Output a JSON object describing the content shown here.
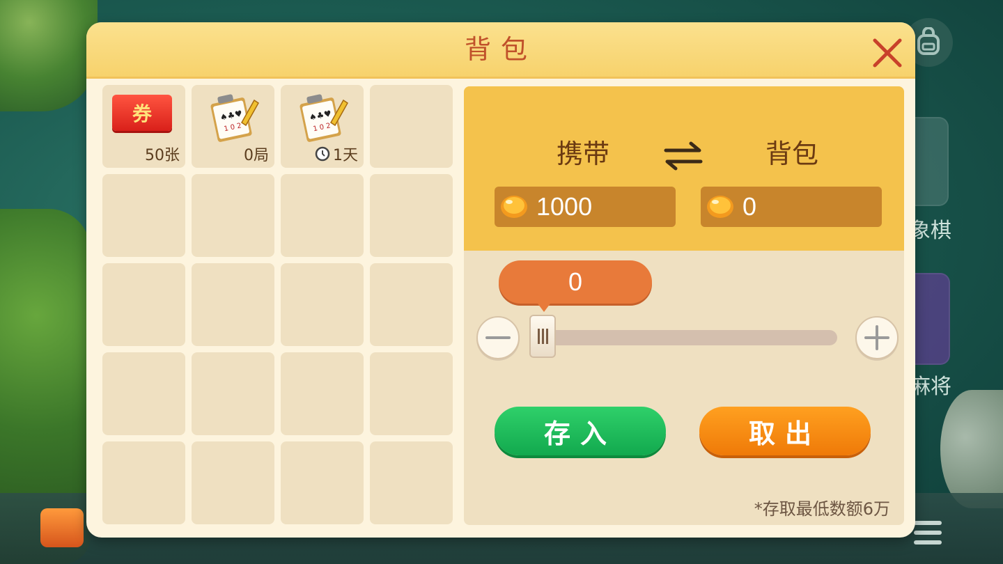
{
  "background": {
    "game_labels": [
      "象棋",
      "麻将"
    ]
  },
  "modal": {
    "title": "背包",
    "close_icon": "close-icon"
  },
  "inventory": {
    "items": [
      {
        "name": "coupon",
        "icon_text": "券",
        "count": "50张"
      },
      {
        "name": "room-card",
        "count": "0局"
      },
      {
        "name": "room-card-timed",
        "count": "1天",
        "has_clock": true
      }
    ],
    "total_slots": 20
  },
  "transfer": {
    "carry_label": "携带",
    "bag_label": "背包",
    "carry_amount": "1000",
    "bag_amount": "0",
    "slider_value": "0",
    "slider_fraction": 0,
    "deposit_label": "存入",
    "withdraw_label": "取出",
    "note": "*存取最低数额6万"
  },
  "colors": {
    "header": "#f7d26c",
    "title": "#c0512a",
    "deposit": "#12a94e",
    "withdraw": "#ef7a08",
    "panel_top": "#f4c24c"
  }
}
